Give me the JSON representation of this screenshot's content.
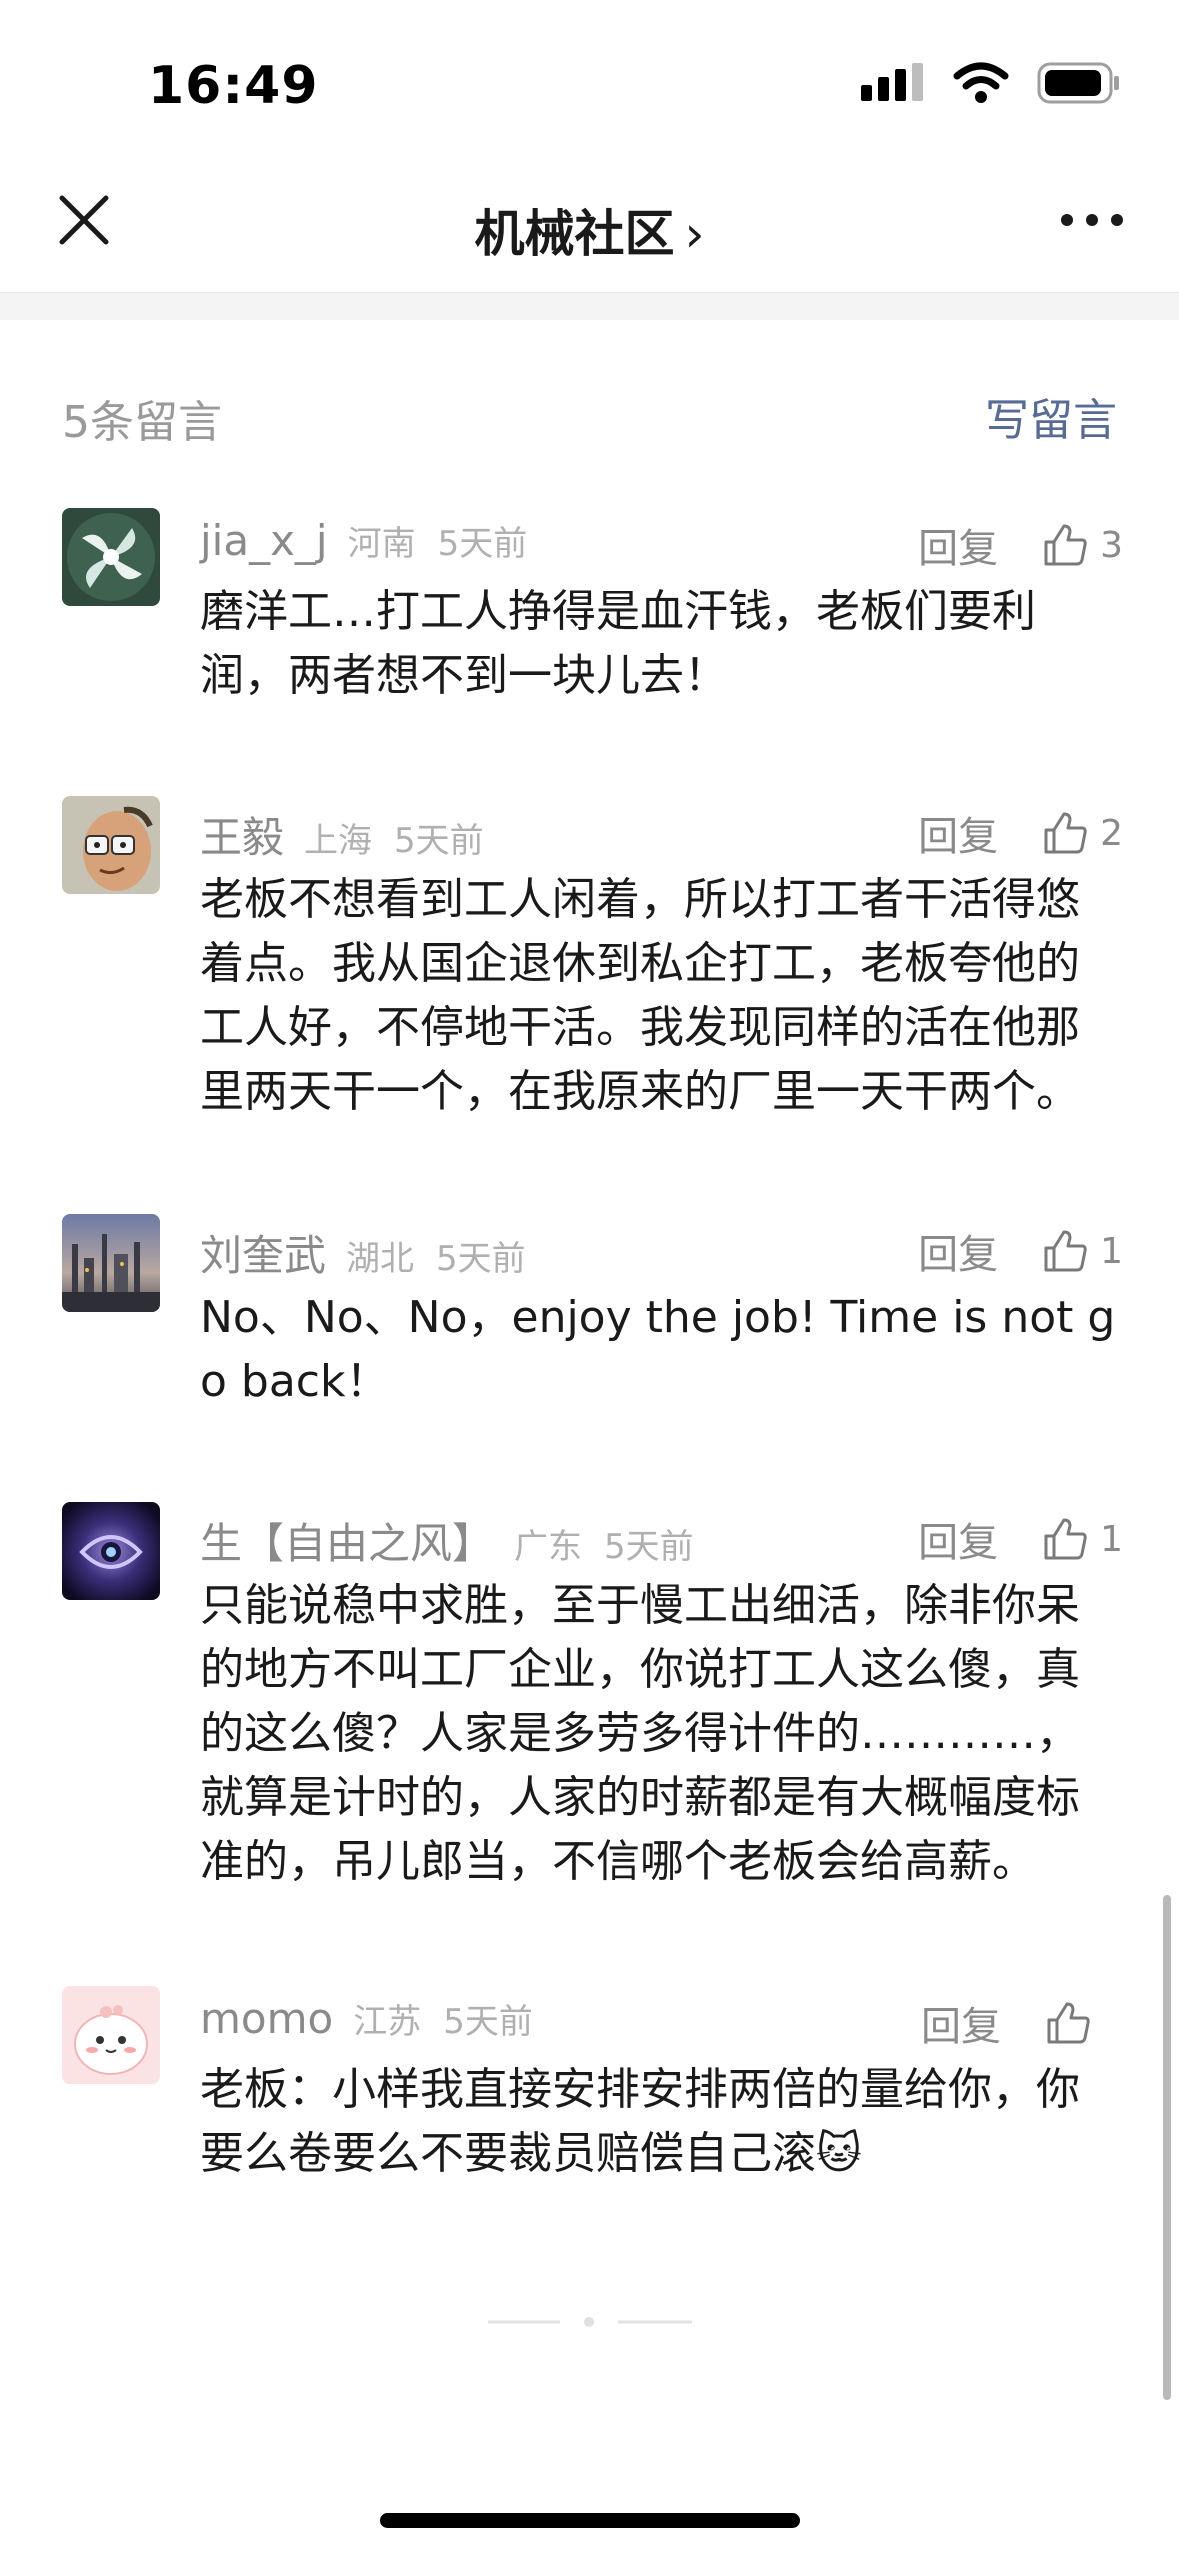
{
  "status_bar": {
    "time": "16:49"
  },
  "nav": {
    "title": "机械社区",
    "chevron": "›",
    "close_icon": "close-icon",
    "more_icon": "more-icon"
  },
  "comments_header": {
    "count_label": "5条留言",
    "write_label": "写留言"
  },
  "colors": {
    "link": "#576b95",
    "muted": "#8a8a8a",
    "text": "#1a1a1a"
  },
  "comments": [
    {
      "username": "jia_x_j",
      "region": "河南",
      "time": "5天前",
      "reply_label": "回复",
      "likes": "3",
      "content": "磨洋工…打工人挣得是血汗钱，老板们要利润，两者想不到一块儿去！"
    },
    {
      "username": "王毅",
      "region": "上海",
      "time": "5天前",
      "reply_label": "回复",
      "likes": "2",
      "content": "老板不想看到工人闲着，所以打工者干活得悠着点。我从国企退休到私企打工，老板夸他的工人好，不停地干活。我发现同样的活在他那里两天干一个，在我原来的厂里一天干两个。"
    },
    {
      "username": "刘奎武",
      "region": "湖北",
      "time": "5天前",
      "reply_label": "回复",
      "likes": "1",
      "content": "No、No、No，enjoy the job! Time is not go back！"
    },
    {
      "username": "生【自由之风】",
      "region": "广东",
      "time": "5天前",
      "reply_label": "回复",
      "likes": "1",
      "content": "只能说稳中求胜，至于慢工出细活，除非你呆的地方不叫工厂企业，你说打工人这么傻，真的这么傻？人家是多劳多得计件的…………，就算是计时的，人家的时薪都是有大概幅度标准的，吊儿郎当，不信哪个老板会给高薪。"
    },
    {
      "username": "momo",
      "region": "江苏",
      "time": "5天前",
      "reply_label": "回复",
      "likes": "",
      "content": "老板：小样我直接安排安排两倍的量给你，你要么卷要么不要裁员赔偿自己滚🐱"
    }
  ]
}
